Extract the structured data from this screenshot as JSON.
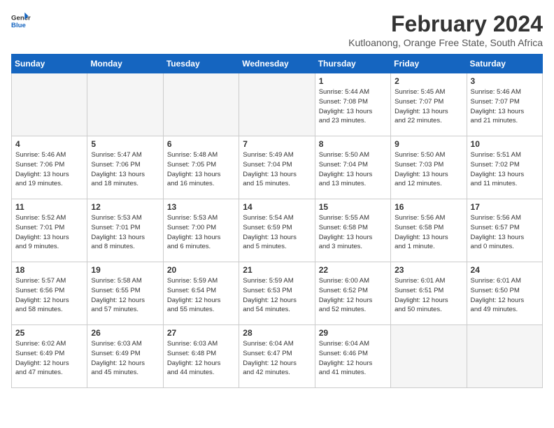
{
  "header": {
    "logo_general": "General",
    "logo_blue": "Blue",
    "month_year": "February 2024",
    "location": "Kutloanong, Orange Free State, South Africa"
  },
  "days_of_week": [
    "Sunday",
    "Monday",
    "Tuesday",
    "Wednesday",
    "Thursday",
    "Friday",
    "Saturday"
  ],
  "weeks": [
    [
      {
        "day": "",
        "info": "",
        "empty": true
      },
      {
        "day": "",
        "info": "",
        "empty": true
      },
      {
        "day": "",
        "info": "",
        "empty": true
      },
      {
        "day": "",
        "info": "",
        "empty": true
      },
      {
        "day": "1",
        "info": "Sunrise: 5:44 AM\nSunset: 7:08 PM\nDaylight: 13 hours\nand 23 minutes."
      },
      {
        "day": "2",
        "info": "Sunrise: 5:45 AM\nSunset: 7:07 PM\nDaylight: 13 hours\nand 22 minutes."
      },
      {
        "day": "3",
        "info": "Sunrise: 5:46 AM\nSunset: 7:07 PM\nDaylight: 13 hours\nand 21 minutes."
      }
    ],
    [
      {
        "day": "4",
        "info": "Sunrise: 5:46 AM\nSunset: 7:06 PM\nDaylight: 13 hours\nand 19 minutes."
      },
      {
        "day": "5",
        "info": "Sunrise: 5:47 AM\nSunset: 7:06 PM\nDaylight: 13 hours\nand 18 minutes."
      },
      {
        "day": "6",
        "info": "Sunrise: 5:48 AM\nSunset: 7:05 PM\nDaylight: 13 hours\nand 16 minutes."
      },
      {
        "day": "7",
        "info": "Sunrise: 5:49 AM\nSunset: 7:04 PM\nDaylight: 13 hours\nand 15 minutes."
      },
      {
        "day": "8",
        "info": "Sunrise: 5:50 AM\nSunset: 7:04 PM\nDaylight: 13 hours\nand 13 minutes."
      },
      {
        "day": "9",
        "info": "Sunrise: 5:50 AM\nSunset: 7:03 PM\nDaylight: 13 hours\nand 12 minutes."
      },
      {
        "day": "10",
        "info": "Sunrise: 5:51 AM\nSunset: 7:02 PM\nDaylight: 13 hours\nand 11 minutes."
      }
    ],
    [
      {
        "day": "11",
        "info": "Sunrise: 5:52 AM\nSunset: 7:01 PM\nDaylight: 13 hours\nand 9 minutes."
      },
      {
        "day": "12",
        "info": "Sunrise: 5:53 AM\nSunset: 7:01 PM\nDaylight: 13 hours\nand 8 minutes."
      },
      {
        "day": "13",
        "info": "Sunrise: 5:53 AM\nSunset: 7:00 PM\nDaylight: 13 hours\nand 6 minutes."
      },
      {
        "day": "14",
        "info": "Sunrise: 5:54 AM\nSunset: 6:59 PM\nDaylight: 13 hours\nand 5 minutes."
      },
      {
        "day": "15",
        "info": "Sunrise: 5:55 AM\nSunset: 6:58 PM\nDaylight: 13 hours\nand 3 minutes."
      },
      {
        "day": "16",
        "info": "Sunrise: 5:56 AM\nSunset: 6:58 PM\nDaylight: 13 hours\nand 1 minute."
      },
      {
        "day": "17",
        "info": "Sunrise: 5:56 AM\nSunset: 6:57 PM\nDaylight: 13 hours\nand 0 minutes."
      }
    ],
    [
      {
        "day": "18",
        "info": "Sunrise: 5:57 AM\nSunset: 6:56 PM\nDaylight: 12 hours\nand 58 minutes."
      },
      {
        "day": "19",
        "info": "Sunrise: 5:58 AM\nSunset: 6:55 PM\nDaylight: 12 hours\nand 57 minutes."
      },
      {
        "day": "20",
        "info": "Sunrise: 5:59 AM\nSunset: 6:54 PM\nDaylight: 12 hours\nand 55 minutes."
      },
      {
        "day": "21",
        "info": "Sunrise: 5:59 AM\nSunset: 6:53 PM\nDaylight: 12 hours\nand 54 minutes."
      },
      {
        "day": "22",
        "info": "Sunrise: 6:00 AM\nSunset: 6:52 PM\nDaylight: 12 hours\nand 52 minutes."
      },
      {
        "day": "23",
        "info": "Sunrise: 6:01 AM\nSunset: 6:51 PM\nDaylight: 12 hours\nand 50 minutes."
      },
      {
        "day": "24",
        "info": "Sunrise: 6:01 AM\nSunset: 6:50 PM\nDaylight: 12 hours\nand 49 minutes."
      }
    ],
    [
      {
        "day": "25",
        "info": "Sunrise: 6:02 AM\nSunset: 6:49 PM\nDaylight: 12 hours\nand 47 minutes."
      },
      {
        "day": "26",
        "info": "Sunrise: 6:03 AM\nSunset: 6:49 PM\nDaylight: 12 hours\nand 45 minutes."
      },
      {
        "day": "27",
        "info": "Sunrise: 6:03 AM\nSunset: 6:48 PM\nDaylight: 12 hours\nand 44 minutes."
      },
      {
        "day": "28",
        "info": "Sunrise: 6:04 AM\nSunset: 6:47 PM\nDaylight: 12 hours\nand 42 minutes."
      },
      {
        "day": "29",
        "info": "Sunrise: 6:04 AM\nSunset: 6:46 PM\nDaylight: 12 hours\nand 41 minutes."
      },
      {
        "day": "",
        "info": "",
        "empty": true
      },
      {
        "day": "",
        "info": "",
        "empty": true
      }
    ]
  ]
}
